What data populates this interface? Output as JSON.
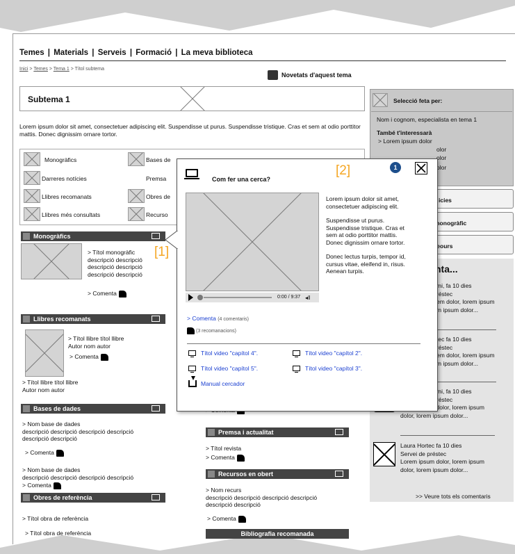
{
  "nav": {
    "items": [
      "Temes",
      "Materials",
      "Serveis",
      "Formació",
      "La meva biblioteca"
    ],
    "breadcrumb": [
      "Inici",
      "Temes",
      "Tema 1",
      "Títol subtema"
    ],
    "news_label": "Novetats d'aquest tema"
  },
  "page_title": "Subtema 1",
  "intro": "Lorem ipsum dolor sit amet, consectetuer adipiscing elit. Suspendisse ut purus. Suspendisse tristique. Cras et sem at odio porttitor mattis. Donec dignissim ornare tortor.",
  "categories": {
    "col1": [
      "Monogràfics",
      "Darreres notícies",
      "Llibres recomanats",
      "Llibres més consultats"
    ],
    "col2": [
      "Bases de",
      "Premsa",
      "Obres de",
      "Recurso"
    ]
  },
  "monografics": {
    "title": "Monogràfics",
    "item": [
      "> Títol monogràfic",
      "descripció descripció",
      "descripció descripció",
      "descripció descripció"
    ],
    "comment": "> Comenta"
  },
  "llibres": {
    "title": "Llibres recomanats",
    "item1": [
      "> Títol llibre títol llibre",
      "Autor nom autor"
    ],
    "comment": "> Comenta",
    "item2": [
      "> Títol llibre títol llibre",
      "Autor nom autor"
    ]
  },
  "bases": {
    "title": "Bases de dades",
    "item1": [
      "> Nom base de dades",
      "descripció descripció descripció descripció",
      "descripció descripció"
    ],
    "comment1": "> Comenta",
    "item2": [
      "> Nom base de dades",
      "descripció descripció descripció descripció"
    ],
    "comment2": "> Comenta"
  },
  "obres": {
    "title": "Obres de referència",
    "item1": "> Títol obra de referència",
    "item2": "> Títol obra de referència"
  },
  "center": {
    "comment_top": "> Comenta",
    "premsa_title": "Premsa i actualitat",
    "premsa_item": "> Títol revista",
    "premsa_comment": "> Comenta",
    "recursos_title": "Recursos en obert",
    "recursos_item": [
      "> Nom recurs",
      "descripció descripció descripció descripció",
      "descripció descripció"
    ],
    "recursos_comment": "> Comenta",
    "biblio": "Bibliografia recomanada"
  },
  "sidebar": {
    "selection_title": "Selecció feta per:",
    "author": "Nom i cognom, especialista en tema 1",
    "also_title": "També t'interessarà",
    "also_items": [
      "> Lorem ipsum dolor",
      "olor",
      "olor",
      "olor"
    ],
    "buttons": [
      "icies",
      "monogràfic",
      "reours"
    ],
    "comments_title": "nta...",
    "comments": [
      [
        "mi, fa 10 dies",
        "réstec",
        "em dolor, lorem ipsum",
        "m ipsum dolor..."
      ],
      [
        "tec fa 10 dies",
        "réstec",
        "em dolor, lorem ipsum",
        "m ipsum dolor..."
      ],
      [
        "mi, fa 10 dies",
        "réstec",
        "Lorem ipsum dolor, lorem ipsum",
        "dolor, lorem ipsum dolor..."
      ]
    ],
    "last_comment": [
      "Laura Hortec fa 10 dies",
      "Servei de préstec",
      "Lorem ipsum dolor, lorem ipsum",
      "dolor, lorem ipsum dolor..."
    ],
    "see_all": ">> Veure tots els comentaris"
  },
  "popup": {
    "title": "Com fer una cerca?",
    "marker1": "[1]",
    "marker2": "[2]",
    "badge": "1",
    "paragraphs": [
      [
        "Lorem ipsum dolor sit amet,",
        "consectetuer adipiscing elit."
      ],
      [
        "Suspendisse ut purus.",
        "Suspendisse tristique. Cras et",
        "sem at odio porttitor mattis.",
        "Donec dignissim ornare tortor."
      ],
      [
        "Donec lectus turpis, tempor id,",
        "cursus vitae, eleifend in, risus.",
        "Aenean turpis."
      ]
    ],
    "time": "0:00 / 9:37",
    "comment_link": "> Comenta",
    "comment_count": "(4 comentaris)",
    "recommend_count": "(3 recomanacions)",
    "videos": [
      "Títol video \"capítol 4\".",
      "Títol video \"capítol 2\".",
      "Títol video \"capítol 5\".",
      "Títol video \"capítol 3\"."
    ],
    "manual": "Manual cercador"
  }
}
